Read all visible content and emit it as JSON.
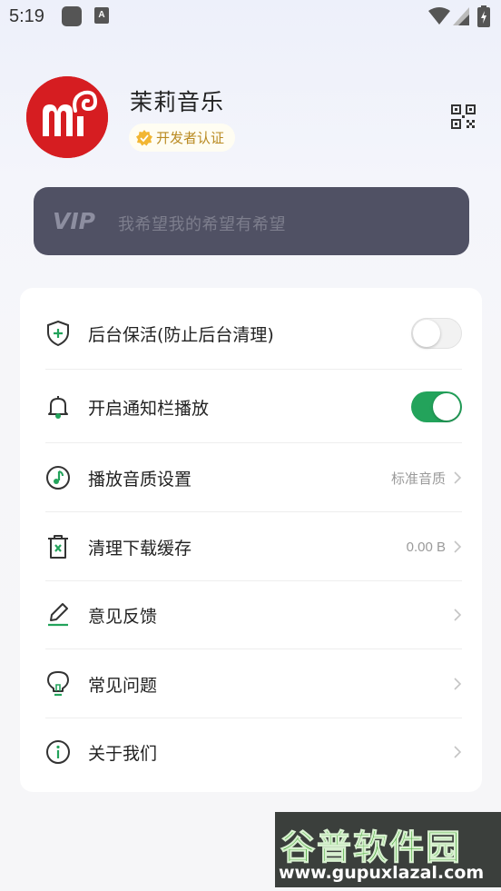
{
  "status_bar": {
    "time": "5:19",
    "app_icon_letter": "A"
  },
  "profile": {
    "app_name": "茉莉音乐",
    "badge_label": "开发者认证",
    "avatar_letter": "m"
  },
  "vip": {
    "logo": "VIP",
    "slogan": "我希望我的希望有希望"
  },
  "settings": [
    {
      "label": "后台保活(防止后台清理)",
      "icon": "shield-plus-icon",
      "control": "toggle",
      "checked": false
    },
    {
      "label": "开启通知栏播放",
      "icon": "bell-icon",
      "control": "toggle",
      "checked": true
    },
    {
      "label": "播放音质设置",
      "icon": "music-note-icon",
      "value": "标准音质",
      "control": "chevron"
    },
    {
      "label": "清理下载缓存",
      "icon": "trash-icon",
      "value": "0.00 B",
      "control": "chevron"
    },
    {
      "label": "意见反馈",
      "icon": "pen-icon",
      "value": "",
      "control": "chevron"
    },
    {
      "label": "常见问题",
      "icon": "bulb-icon",
      "value": "",
      "control": "chevron"
    },
    {
      "label": "关于我们",
      "icon": "info-icon",
      "value": "",
      "control": "chevron"
    }
  ],
  "watermark": {
    "title": "谷普软件园",
    "url": "www.gupuxlazal.com"
  },
  "colors": {
    "accent_green": "#23a35b",
    "avatar_red": "#d61d21",
    "vip_card": "#505164",
    "badge_gold": "#b98a22"
  }
}
